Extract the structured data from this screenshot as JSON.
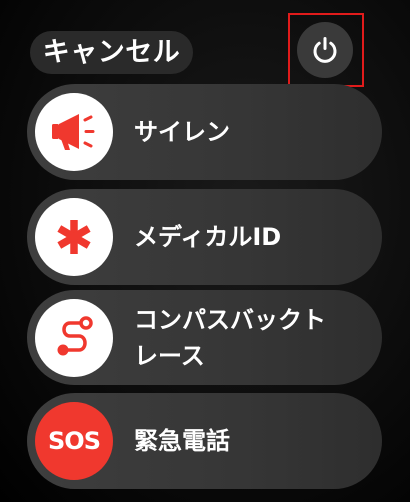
{
  "cancel": {
    "label": "キャンセル"
  },
  "power": {
    "icon": "power-icon"
  },
  "sliders": [
    {
      "label": "サイレン",
      "icon": "megaphone-icon"
    },
    {
      "label": "メディカルID",
      "icon": "medical-asterisk-icon"
    },
    {
      "label_line1": "コンパスバックト",
      "label_line2": "レース",
      "icon": "route-icon"
    },
    {
      "label": "緊急電話",
      "icon_text": "SOS"
    }
  ],
  "colors": {
    "accent": "#f0382e",
    "highlight": "#e11b1b"
  }
}
